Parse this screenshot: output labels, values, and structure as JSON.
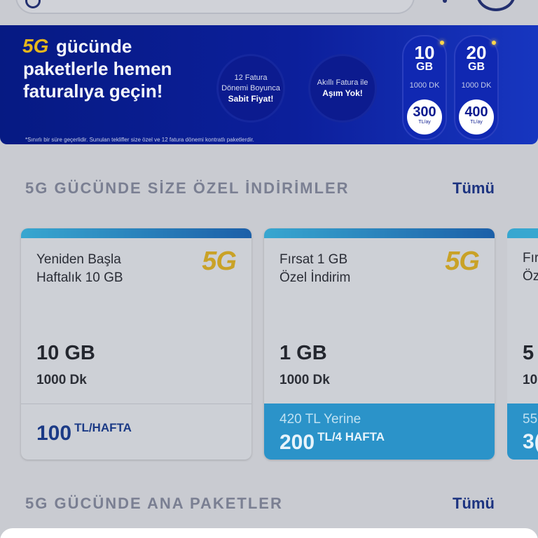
{
  "colors": {
    "accent": "#1c3380",
    "card_footer_blue": "#2b93c9",
    "banner_blue": "#0c1f9b",
    "brand_gold": "#c9a227"
  },
  "banner": {
    "brand": "5G",
    "headline_1": "gücünde",
    "headline_2": "paketlerle hemen",
    "headline_3": "faturalıya geçin!",
    "bubble1_l1": "12 Fatura",
    "bubble1_l2": "Dönemi Boyunca",
    "bubble1_l3": "Sabit Fiyat!",
    "bubble2_l1": "Akıllı Fatura ile",
    "bubble2_l2": "Aşım Yok!",
    "offers": [
      {
        "gb": "10",
        "gb_unit": "GB",
        "minutes": "1000 DK",
        "price": "300",
        "price_unit": "TL/ay"
      },
      {
        "gb": "20",
        "gb_unit": "GB",
        "minutes": "1000 DK",
        "price": "400",
        "price_unit": "TL/ay"
      }
    ],
    "disclaimer": "*Sınırlı bir süre geçerlidir. Sunulan teklifler size özel ve 12 fatura dönemi kontratlı paketlerdir."
  },
  "section1": {
    "title": "5G GÜCÜNDE SİZE ÖZEL İNDİRİMLER",
    "more": "Tümü"
  },
  "cards": [
    {
      "name_l1": "Yeniden Başla",
      "name_l2": "Haftalık 10 GB",
      "badge": "5G",
      "data": "10 GB",
      "minutes": "1000 Dk",
      "old_price": "",
      "price": "100",
      "price_unit": "TL/HAFTA"
    },
    {
      "name_l1": "Fırsat 1 GB",
      "name_l2": "Özel İndirim",
      "badge": "5G",
      "data": "1 GB",
      "minutes": "1000 Dk",
      "old_price": "420 TL Yerine",
      "price": "200",
      "price_unit": "TL/4 HAFTA"
    }
  ],
  "card3_partial": {
    "l1": "Fır",
    "l2": "Öz",
    "data": "5",
    "minutes": "10",
    "old": "55",
    "price": "3("
  },
  "section2": {
    "title": "5G GÜCÜNDE ANA PAKETLER",
    "more": "Tümü"
  }
}
